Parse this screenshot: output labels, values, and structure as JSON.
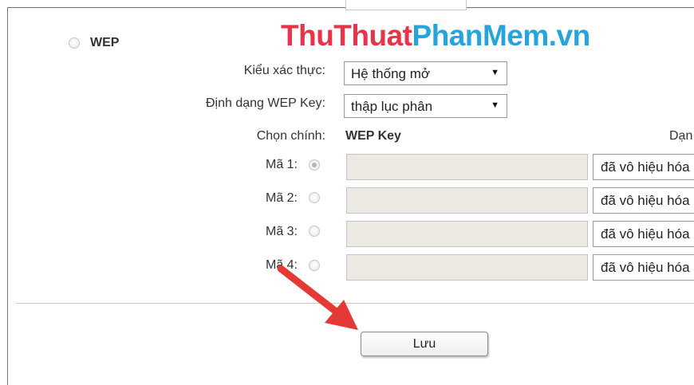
{
  "watermark": {
    "part1": "ThuThuat",
    "part2": "PhanMem",
    "part3": ".vn"
  },
  "security": {
    "wep_label": "WEP",
    "auth_type_label": "Kiểu xác thực:",
    "auth_type_value": "Hệ thống mở",
    "key_format_label": "Định dạng WEP Key:",
    "key_format_value": "thập lục phân",
    "select_arrow": "▼",
    "key_select_label": "Chọn chính:",
    "wep_key_header": "WEP Key",
    "key_type_header": "Dạn",
    "keys": [
      {
        "label": "Mã 1:",
        "selected": true,
        "value": "",
        "type": "đã vô hiệu hóa"
      },
      {
        "label": "Mã 2:",
        "selected": false,
        "value": "",
        "type": "đã vô hiệu hóa"
      },
      {
        "label": "Mã 3:",
        "selected": false,
        "value": "",
        "type": "đã vô hiệu hóa"
      },
      {
        "label": "Mã 4:",
        "selected": false,
        "value": "",
        "type": "đã vô hiệu hóa"
      }
    ]
  },
  "actions": {
    "save_label": "Lưu"
  },
  "colors": {
    "watermark_red": "#e8344a",
    "watermark_blue": "#27a4dd",
    "arrow_red": "#e53935"
  }
}
